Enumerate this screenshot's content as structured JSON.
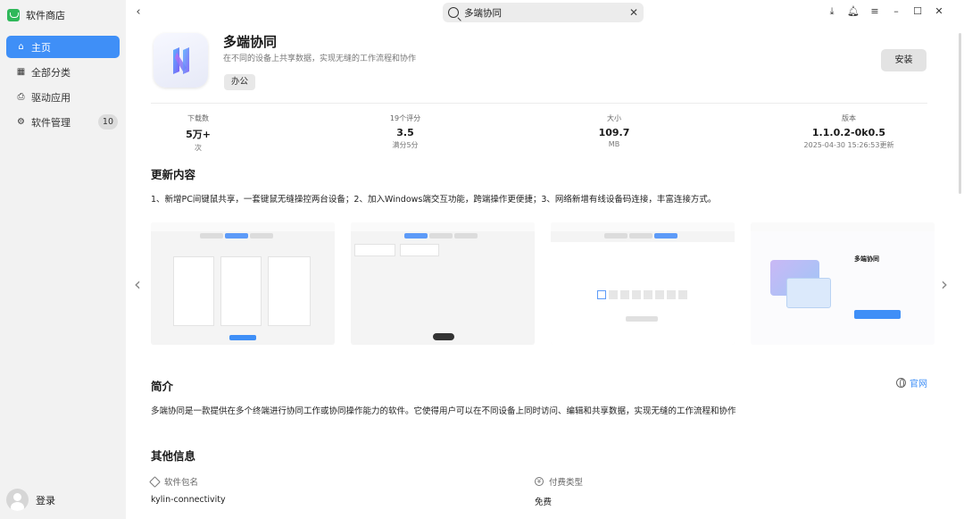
{
  "sidebar": {
    "app_name": "软件商店",
    "items": [
      {
        "label": "主页",
        "icon": "home-icon",
        "active": true
      },
      {
        "label": "全部分类",
        "icon": "grid-icon"
      },
      {
        "label": "驱动应用",
        "icon": "printer-icon"
      },
      {
        "label": "软件管理",
        "icon": "gear-icon",
        "badge": "10"
      }
    ],
    "login_label": "登录"
  },
  "search": {
    "value": "多端协同"
  },
  "app": {
    "title": "多端协同",
    "description": "在不同的设备上共享数据，实现无缝的工作流程和协作",
    "tag": "办公",
    "install_label": "安装"
  },
  "stats": [
    {
      "label": "下载数",
      "value": "5万+",
      "sub": "次"
    },
    {
      "label": "19个评分",
      "value": "3.5",
      "sub": "满分5分"
    },
    {
      "label": "大小",
      "value": "109.7",
      "sub": "MB"
    },
    {
      "label": "版本",
      "value": "1.1.0.2-0k0.5",
      "sub": "2025-04-30 15:26:53更新"
    }
  ],
  "updates": {
    "heading": "更新内容",
    "text": "1、新增PC间键鼠共享，一套键鼠无缝操控两台设备；2、加入Windows端交互功能，跨端操作更便捷；3、网络新增有线设备码连接，丰富连接方式。"
  },
  "intro": {
    "heading": "简介",
    "official_link": "官网",
    "text": "多端协同是一款提供在多个终端进行协同工作或协同操作能力的软件。它使得用户可以在不同设备上同时访问、编辑和共享数据，实现无缝的工作流程和协作"
  },
  "screenshots": {
    "shot4_title": "多端协同"
  },
  "other_info": {
    "heading": "其他信息",
    "package_label": "软件包名",
    "package_value": "kylin-connectivity",
    "pay_label": "付费类型",
    "pay_value": "免费"
  },
  "colors": {
    "accent": "#3f8ff7",
    "sidebar_bg": "#f2f2f2"
  }
}
